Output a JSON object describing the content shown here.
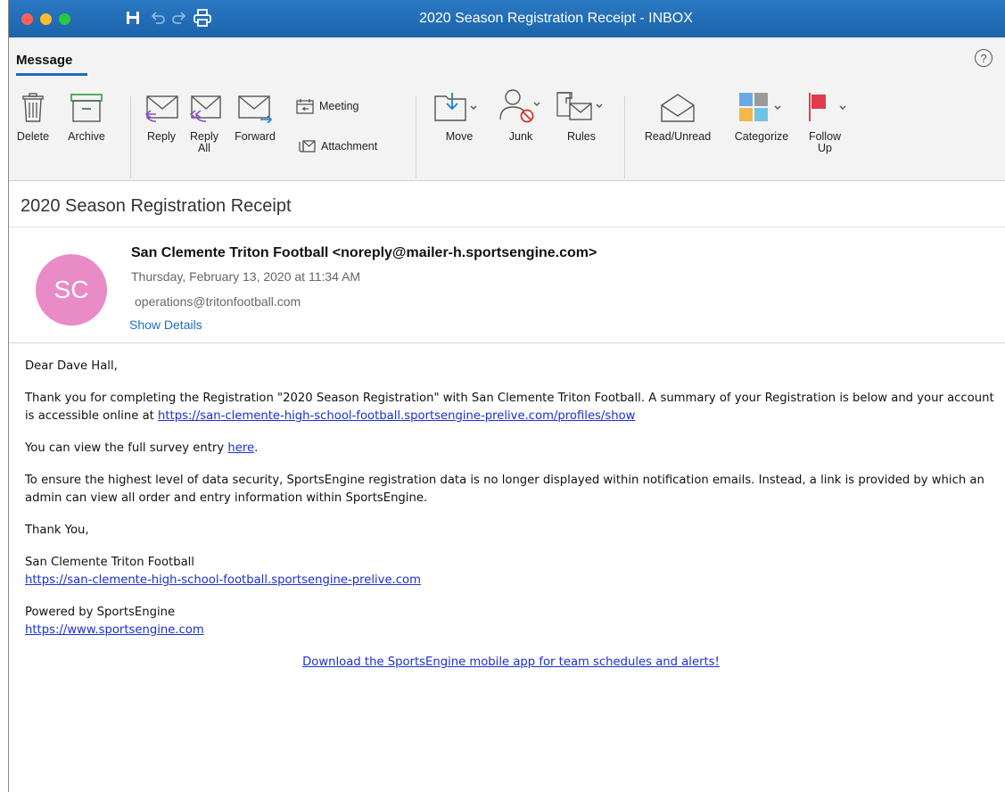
{
  "window": {
    "title": "2020 Season Registration Receipt - INBOX"
  },
  "ribbon": {
    "tab": "Message",
    "help": "?",
    "buttons": {
      "delete": "Delete",
      "archive": "Archive",
      "reply": "Reply",
      "reply_all_1": "Reply",
      "reply_all_2": "All",
      "forward": "Forward",
      "meeting": "Meeting",
      "attachment": "Attachment",
      "move": "Move",
      "junk": "Junk",
      "rules": "Rules",
      "read_unread": "Read/Unread",
      "categorize": "Categorize",
      "follow_up_1": "Follow",
      "follow_up_2": "Up"
    }
  },
  "message": {
    "subject": "2020 Season Registration Receipt",
    "avatar_initials": "SC",
    "from": "San Clemente Triton Football <noreply@mailer-h.sportsengine.com>",
    "date": "Thursday, February 13, 2020 at 11:34 AM",
    "to": "operations@tritonfootball.com",
    "show_details": "Show Details"
  },
  "body": {
    "greeting": "Dear Dave Hall,",
    "para1": "Thank you for completing the Registration \"2020 Season Registration\" with San Clemente Triton Football. A summary of your Registration is below and your account is accessible online at ",
    "para1_link": "https://san-clemente-high-school-football.sportsengine-prelive.com/profiles/show",
    "para2_pre": "You can view the full survey entry ",
    "para2_link": "here",
    "para2_post": ".",
    "para3": "To ensure the highest level of data security, SportsEngine registration data is no longer displayed within notification emails. Instead, a link is provided by which an admin can view all order and entry information within SportsEngine.",
    "thanks": "Thank You,",
    "org_name": "San Clemente Triton Football",
    "org_link": "https://san-clemente-high-school-football.sportsengine-prelive.com",
    "powered": "Powered by SportsEngine",
    "powered_link": "https://www.sportsengine.com",
    "app_link": "Download the SportsEngine mobile app for team schedules and alerts!"
  },
  "colors": {
    "titlebar": "#1f6db5",
    "avatar": "#e88bc6",
    "link": "#1a2fd6"
  }
}
